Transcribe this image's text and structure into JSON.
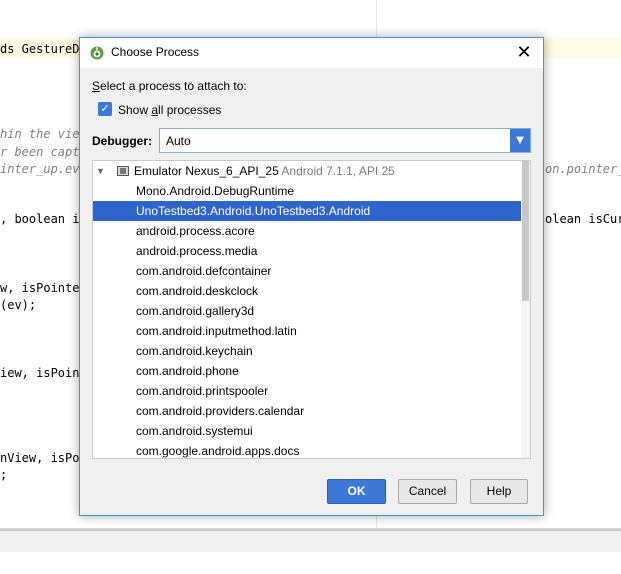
{
  "background_editor": {
    "lines": [
      {
        "text": "ds GestureDe",
        "style": "normal",
        "row": "top1"
      },
      {
        "text": "hin the view",
        "style": "comment",
        "row": "c1"
      },
      {
        "text": "r been captu",
        "style": "comment",
        "row": "c2"
      },
      {
        "text": "inter_up.eve",
        "style": "comment",
        "row": "c3"
      },
      {
        "text": "on.pointer_",
        "style": "comment",
        "row": "c3r"
      },
      {
        "text": ", boolean is",
        "style": "mixed",
        "row": "b1"
      },
      {
        "text": "olean isCur",
        "style": "mixed",
        "row": "b1r"
      },
      {
        "text": "w, isPointer",
        "style": "normal",
        "row": "d1"
      },
      {
        "text": "(ev);",
        "style": "normal",
        "row": "d2"
      },
      {
        "text": "iew, isPoint",
        "style": "normal",
        "row": "e1"
      },
      {
        "text": "nView, isPoi",
        "style": "normal",
        "row": "f1"
      },
      {
        "text": ";",
        "style": "normal",
        "row": "f2"
      }
    ]
  },
  "dialog": {
    "title": "Choose Process",
    "close_glyph": "✕",
    "select_prompt_prefix": "",
    "select_prompt_u": "S",
    "select_prompt_rest": "elect a process to attach to:",
    "show_all": {
      "pre": "Show ",
      "u": "a",
      "post": "ll processes",
      "checked": true,
      "check_glyph": "✓"
    },
    "debugger_label": "Debugger:",
    "debugger_value": "Auto",
    "dropdown_arrow": "▼",
    "device": {
      "expand_glyph": "▼",
      "name": "Emulator Nexus_6_API_25",
      "info": "Android 7.1.1, API 25"
    },
    "processes": [
      "Mono.Android.DebugRuntime",
      "UnoTestbed3.Android.UnoTestbed3.Android",
      "android.process.acore",
      "android.process.media",
      "com.android.defcontainer",
      "com.android.deskclock",
      "com.android.gallery3d",
      "com.android.inputmethod.latin",
      "com.android.keychain",
      "com.android.phone",
      "com.android.printspooler",
      "com.android.providers.calendar",
      "com.android.systemui",
      "com.google.android.apps.docs"
    ],
    "selected_process": "UnoTestbed3.Android.UnoTestbed3.Android",
    "buttons": {
      "ok": "OK",
      "cancel": "Cancel",
      "help": "Help"
    }
  },
  "colors": {
    "accent": "#3b78d8",
    "selection": "#2f65ca",
    "dialog_bg": "#f0f0f0"
  }
}
